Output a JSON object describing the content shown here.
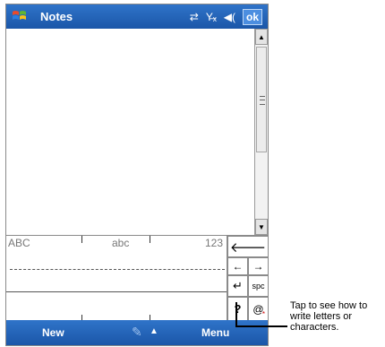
{
  "app": {
    "title": "Notes"
  },
  "titlebar": {
    "logo": "windows-flag-icon",
    "status_icons": [
      "connectivity-icon",
      "no-signal-icon",
      "speaker-icon"
    ],
    "ok_label": "ok"
  },
  "scrollbar": {
    "up": "▲",
    "down": "▼"
  },
  "input_panel": {
    "zones": {
      "upper": "ABC",
      "lower": "abc",
      "numbers": "123"
    },
    "keys": {
      "backspace": "🡐",
      "left": "←",
      "right": "→",
      "enter": "↵",
      "space": "spc",
      "help": "?",
      "symbols": "@",
      "symbols_star": "*"
    }
  },
  "bottombar": {
    "left_softkey": "New",
    "right_softkey": "Menu",
    "input_method_icon": "pen-icon",
    "caret": "▲"
  },
  "callout": {
    "text": "Tap to see how to write letters or characters."
  },
  "colors": {
    "bar": "#1f5db0",
    "bar_light": "#2f74c9"
  }
}
